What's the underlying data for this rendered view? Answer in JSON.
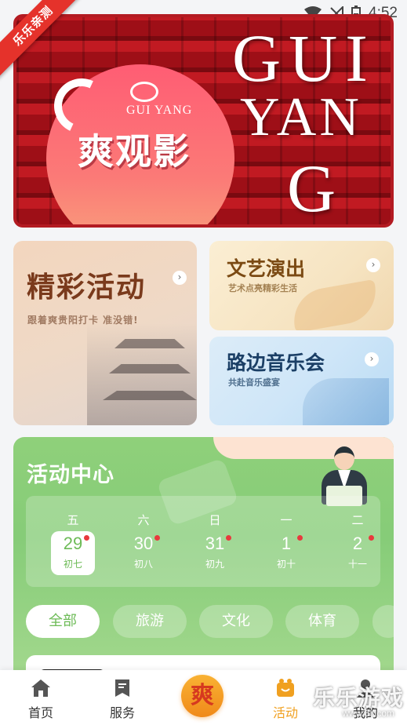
{
  "status_bar": {
    "time": "4:52",
    "icons": [
      "wifi-icon",
      "signal-icon",
      "battery-icon"
    ]
  },
  "ribbon": {
    "label": "乐乐亲测"
  },
  "hero": {
    "subtitle": "GUI YANG",
    "title": "爽观影",
    "big_letters": [
      "GUI",
      "YAN",
      "G"
    ]
  },
  "cards": {
    "featured": {
      "title": "精彩活动",
      "subtitle": "跟着爽贵阳打卡 准没错!"
    },
    "performance": {
      "title": "文艺演出",
      "subtitle": "艺术点亮精彩生活"
    },
    "street_concert": {
      "title": "路边音乐会",
      "subtitle": "共赴音乐盛宴"
    }
  },
  "activity_center": {
    "title": "活动中心",
    "days": [
      {
        "weekday": "五",
        "date": "29",
        "lunar": "初七",
        "active": true
      },
      {
        "weekday": "六",
        "date": "30",
        "lunar": "初八",
        "active": false
      },
      {
        "weekday": "日",
        "date": "31",
        "lunar": "初九",
        "active": false
      },
      {
        "weekday": "一",
        "date": "1",
        "lunar": "初十",
        "active": false
      },
      {
        "weekday": "二",
        "date": "2",
        "lunar": "十一",
        "active": false
      }
    ],
    "filters": [
      "全部",
      "旅游",
      "文化",
      "体育"
    ]
  },
  "tabbar": {
    "items": [
      {
        "label": "首页",
        "icon": "home-icon"
      },
      {
        "label": "服务",
        "icon": "service-icon"
      },
      {
        "label": "活动",
        "icon": "activity-icon",
        "active": true
      },
      {
        "label": "我的",
        "icon": "profile-icon"
      }
    ],
    "center_icon": "logo-icon",
    "center_glyph": "爽"
  },
  "watermark": {
    "text": "乐乐游戏",
    "url": "www.6ll.com"
  },
  "colors": {
    "accent": "#f0a020",
    "green": "#86cc78",
    "red": "#e5322b"
  }
}
